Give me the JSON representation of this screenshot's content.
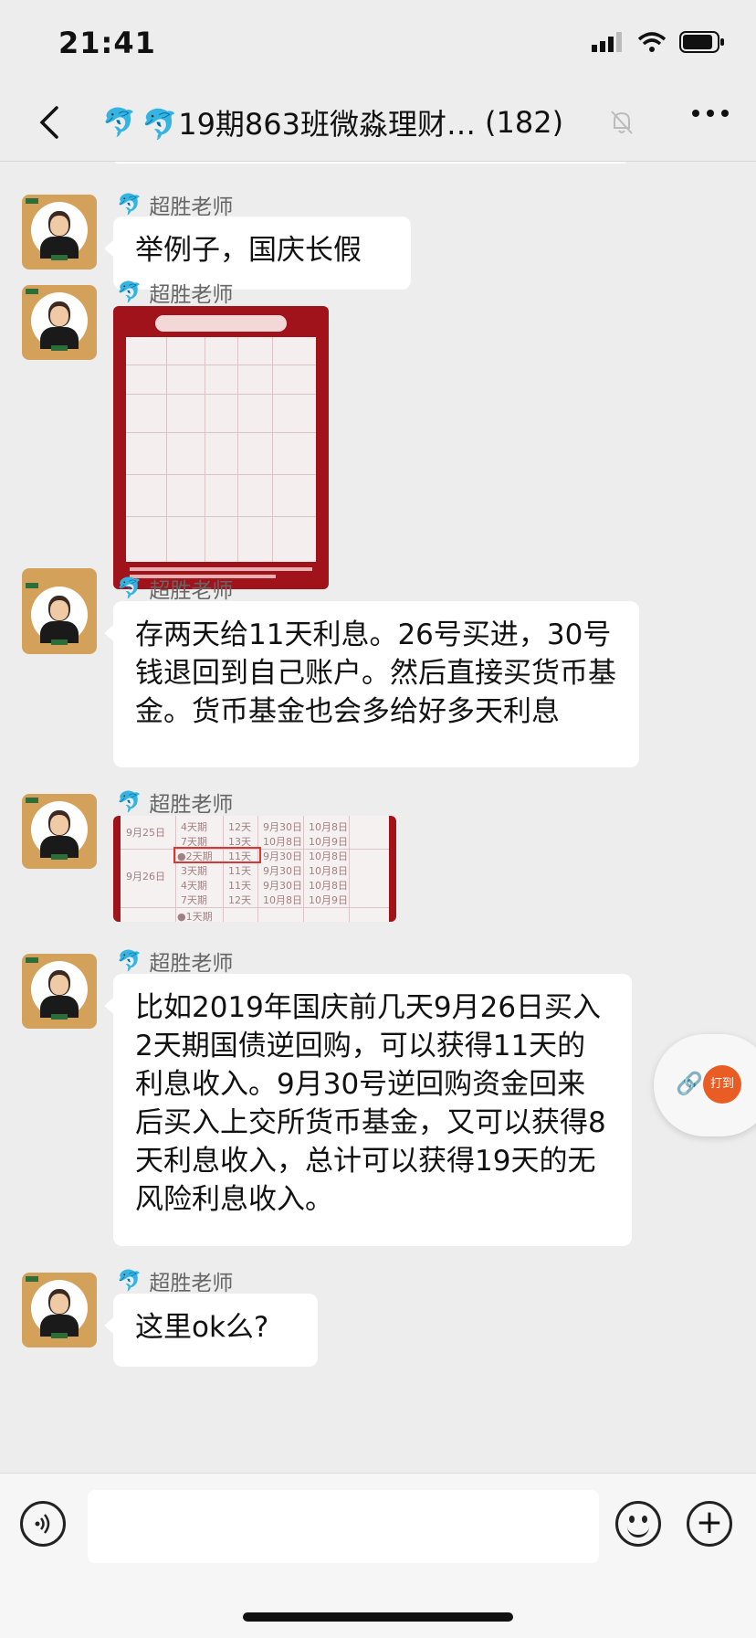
{
  "status_bar": {
    "time": "21:41"
  },
  "header": {
    "prefix_icon": "dolphin-emoji",
    "title": "🐬19期863班微淼理财…",
    "member_count": "(182)",
    "muted_icon": "bell-off-icon",
    "more_icon": "more-dots-icon",
    "back_icon": "chevron-left-icon"
  },
  "messages": [
    {
      "sender": "超胜老师",
      "type": "text",
      "text": "举例子，国庆长假"
    },
    {
      "sender": "超胜老师",
      "type": "image",
      "image_desc": "red table image"
    },
    {
      "sender": "超胜老师",
      "type": "text",
      "text": "存两天给11天利息。26号买进，30号钱退回到自己账户。然后直接买货币基金。货币基金也会多给好多天利息"
    },
    {
      "sender": "超胜老师",
      "type": "image",
      "image_desc": "table crop"
    },
    {
      "sender": "超胜老师",
      "type": "text",
      "text": "比如2019年国庆前几天9月26日买入2天期国债逆回购，可以获得11天的利息收入。9月30号逆回购资金回来后买入上交所货币基金，又可以获得8天利息收入，总计可以获得19天的无风险利息收入。"
    },
    {
      "sender": "超胜老师",
      "type": "text",
      "text": "这里ok么?"
    }
  ],
  "img2_table": {
    "rows": [
      [
        "9月25日",
        "4天期",
        "12天",
        "9月30日",
        "10月8日"
      ],
      [
        "",
        "7天期",
        "13天",
        "10月8日",
        "10月9日"
      ],
      [
        "",
        "●2天期",
        "11天",
        "9月30日",
        "10月8日"
      ],
      [
        "9月26日",
        "3天期",
        "11天",
        "9月30日",
        "10月8日"
      ],
      [
        "",
        "4天期",
        "11天",
        "9月30日",
        "10月8日"
      ],
      [
        "",
        "7天期",
        "12天",
        "10月8日",
        "10月9日"
      ],
      [
        "",
        "●1天期",
        "",
        "",
        ""
      ]
    ]
  },
  "float_widget": {
    "sign_label": "打到"
  },
  "input_bar": {
    "voice_icon": "voice-icon",
    "emoji_icon": "emoji-icon",
    "plus_icon": "plus-icon"
  }
}
